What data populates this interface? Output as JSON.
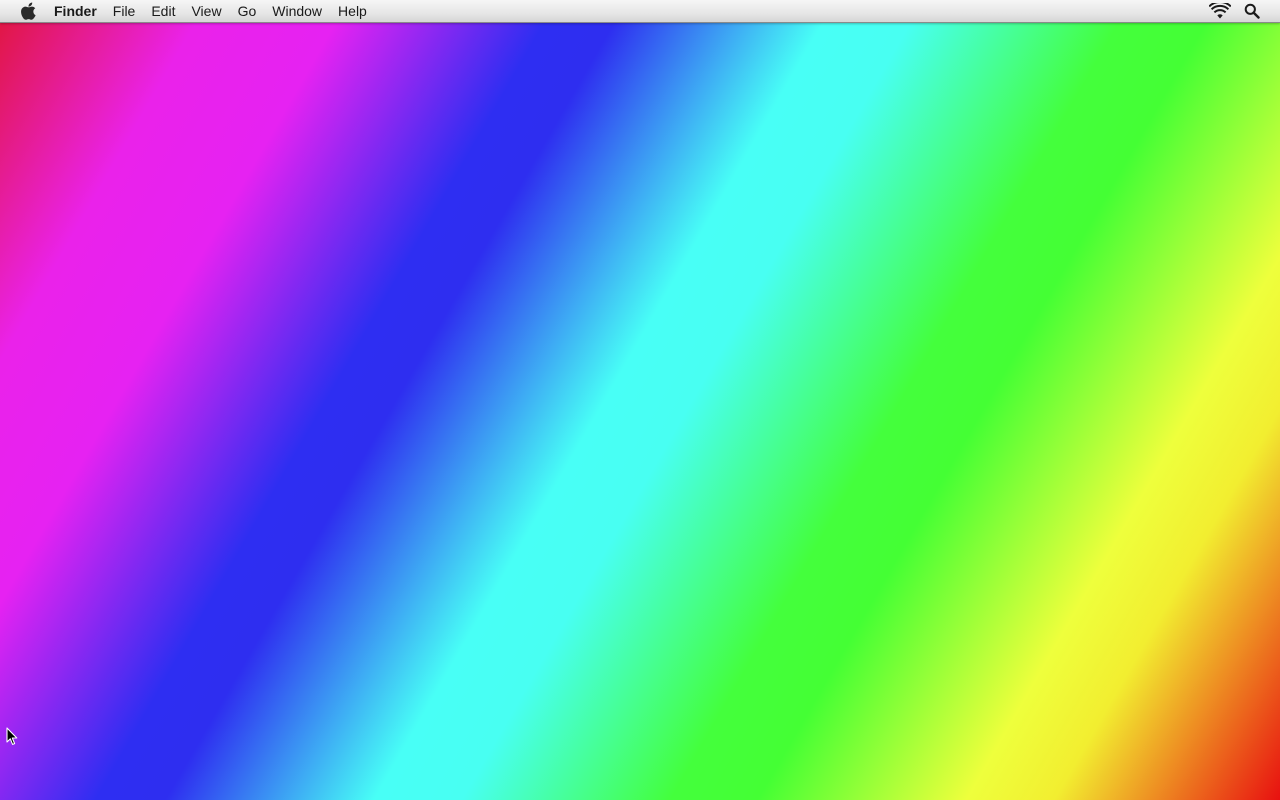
{
  "menubar": {
    "apple_icon": "apple-logo-icon",
    "app_name": "Finder",
    "items": [
      {
        "label": "File"
      },
      {
        "label": "Edit"
      },
      {
        "label": "View"
      },
      {
        "label": "Go"
      },
      {
        "label": "Window"
      },
      {
        "label": "Help"
      }
    ],
    "status_icons": [
      "wifi-icon",
      "spotlight-search-icon"
    ]
  },
  "desktop": {
    "wallpaper_colors": [
      "#e0163a",
      "#e622f2",
      "#2e2ef2",
      "#48fff6",
      "#44ff34",
      "#eeff3c",
      "#e81010"
    ]
  }
}
